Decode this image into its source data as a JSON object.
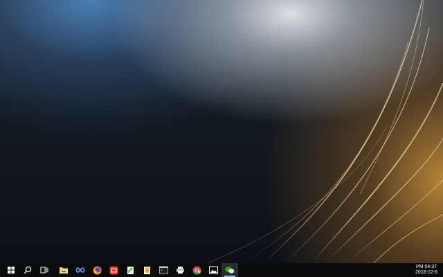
{
  "desktop": {
    "wallpaper": "abstract-golden-light-streaks",
    "accent_colors": [
      "#4f8fd0",
      "#e8e8ea",
      "#d39a3c",
      "#0c1016"
    ]
  },
  "taskbar": {
    "items": [
      {
        "name": "start-button",
        "icon": "windows-logo-icon"
      },
      {
        "name": "search-button",
        "icon": "search-icon"
      },
      {
        "name": "task-view-button",
        "icon": "task-view-icon"
      },
      {
        "name": "file-explorer",
        "icon": "folder-icon"
      },
      {
        "name": "baidu-netdisk",
        "icon": "infinity-icon"
      },
      {
        "name": "firefox",
        "icon": "firefox-icon"
      },
      {
        "name": "app-red",
        "icon": "red-app-icon"
      },
      {
        "name": "notepad-plus",
        "icon": "notepad-icon"
      },
      {
        "name": "document-app",
        "icon": "document-icon"
      },
      {
        "name": "terminal",
        "icon": "terminal-icon"
      },
      {
        "name": "printer-app",
        "icon": "printer-icon"
      },
      {
        "name": "chrome",
        "icon": "chrome-icon"
      },
      {
        "name": "photos",
        "icon": "photos-icon"
      },
      {
        "name": "wechat",
        "icon": "wechat-icon"
      }
    ]
  },
  "clock": {
    "time": "PM 04:37",
    "date": "2018-12-6"
  }
}
